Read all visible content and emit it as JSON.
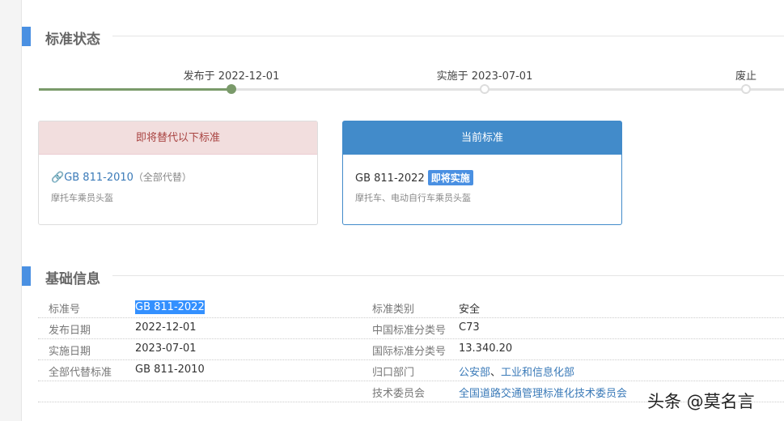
{
  "status_section": {
    "title": "标准状态"
  },
  "timeline": [
    {
      "label": "发布于 2022-12-01",
      "done": true
    },
    {
      "label": "实施于 2023-07-01",
      "done": false
    },
    {
      "label": "废止",
      "done": false
    }
  ],
  "replaced_card": {
    "header": "即将替代以下标准",
    "code": "GB 811-2010",
    "note": "（全部代替）",
    "desc": "摩托车乘员头盔"
  },
  "current_card": {
    "header": "当前标准",
    "code": "GB 811-2022",
    "badge": "即将实施",
    "desc": "摩托车、电动自行车乘员头盔"
  },
  "info_section": {
    "title": "基础信息"
  },
  "info": {
    "rows": [
      {
        "l1": "标准号",
        "v1": "GB 811-2022",
        "l2": "标准类别",
        "v2": "安全"
      },
      {
        "l1": "发布日期",
        "v1": "2022-12-01",
        "l2": "中国标准分类号",
        "v2": "C73"
      },
      {
        "l1": "实施日期",
        "v1": "2023-07-01",
        "l2": "国际标准分类号",
        "v2": "13.340.20"
      },
      {
        "l1": "全部代替标准",
        "v1": "GB 811-2010",
        "l2": "归口部门",
        "v2a": "公安部",
        "sep": "、",
        "v2b": "工业和信息化部"
      },
      {
        "l2": "技术委员会",
        "v2": "全国道路交通管理标准化技术委员会"
      }
    ]
  },
  "watermark": "头条 @莫名言",
  "colors": {
    "accent": "#4a90e2",
    "done": "#7a9a6a",
    "link": "#3a7ab8"
  }
}
